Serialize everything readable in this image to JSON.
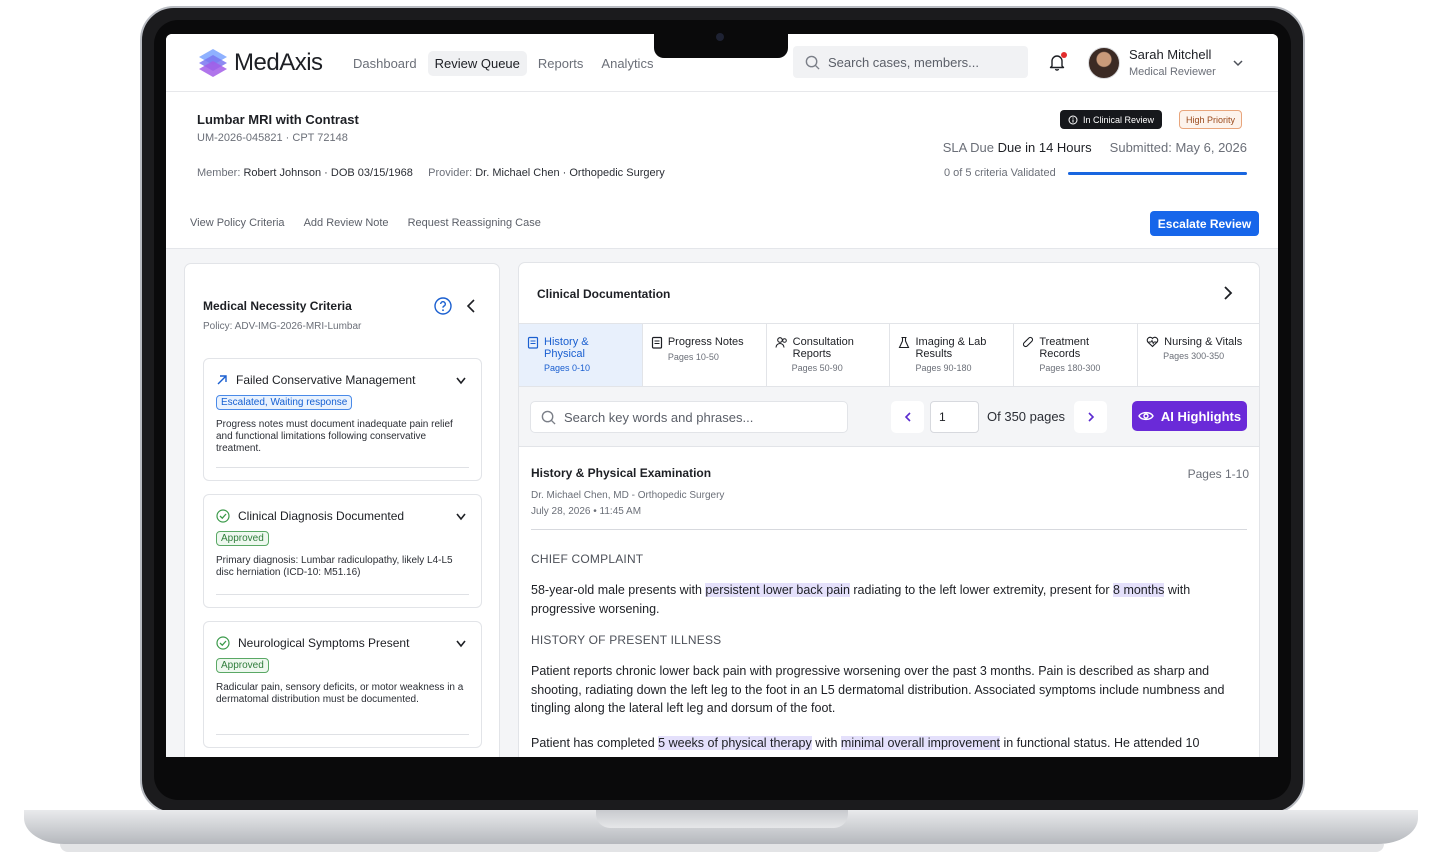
{
  "app": {
    "logo": "MedAxis",
    "nav": [
      "Dashboard",
      "Review Queue",
      "Reports",
      "Analytics"
    ],
    "active_nav": "Review Queue",
    "search_placeholder": "Search cases, members...",
    "user": {
      "name": "Sarah Mitchell",
      "role": "Medical Reviewer"
    }
  },
  "case": {
    "title": "Lumbar MRI with Contrast",
    "id_line": "UM-2026-045821 · CPT 72148",
    "member_label": "Member:",
    "member_value": "Robert Johnson · DOB 03/15/1968",
    "provider_label": "Provider:",
    "provider_value": "Dr. Michael Chen · Orthopedic Surgery",
    "status_badge": "In Clinical Review",
    "priority_badge": "High Priority",
    "sla_label": "SLA Due",
    "sla_value": "Due in 14 Hours",
    "submitted_label": "Submitted:",
    "submitted_value": "May 6, 2026",
    "criteria_progress_text": "0 of 5 criteria Validated",
    "criteria_progress_fraction": 1.0,
    "actions": [
      "View Policy Criteria",
      "Add Review Note",
      "Request Reassigning Case"
    ],
    "escalate_label": "Escalate Review"
  },
  "criteria_panel": {
    "title": "Medical Necessity Criteria",
    "policy": "Policy: ADV-IMG-2026-MRI-Lumbar",
    "items": [
      {
        "name": "Failed Conservative Management",
        "status": "Escalated, Waiting response",
        "status_type": "escalated",
        "icon": "arrow-up-right-icon",
        "text": "Progress notes must document inadequate pain relief and functional limitations following conservative treatment."
      },
      {
        "name": "Clinical Diagnosis Documented",
        "status": "Approved",
        "status_type": "approved",
        "icon": "check-circle-icon",
        "text": "Primary diagnosis: Lumbar radiculopathy, likely L4-L5 disc herniation (ICD-10: M51.16)"
      },
      {
        "name": "Neurological Symptoms Present",
        "status": "Approved",
        "status_type": "approved",
        "icon": "check-circle-icon",
        "text": "Radicular pain, sensory deficits, or motor weakness in a dermatomal distribution must be documented."
      }
    ]
  },
  "docs": {
    "title": "Clinical Documentation",
    "tabs": [
      {
        "label": "History & Physical",
        "pages": "Pages 0-10",
        "icon": "clipboard-icon"
      },
      {
        "label": "Progress Notes",
        "pages": "Pages 10-50",
        "icon": "notes-icon"
      },
      {
        "label": "Consultation Reports",
        "pages": "Pages 50-90",
        "icon": "users-icon"
      },
      {
        "label": "Imaging & Lab Results",
        "pages": "Pages 90-180",
        "icon": "flask-icon"
      },
      {
        "label": "Treatment Records",
        "pages": "Pages 180-300",
        "icon": "pill-icon"
      },
      {
        "label": "Nursing & Vitals",
        "pages": "Pages 300-350",
        "icon": "heart-pulse-icon"
      }
    ],
    "search_placeholder": "Search key words and phrases...",
    "page_value": "1",
    "page_total": "Of 350 pages",
    "ai_label": "AI Highlights",
    "section_title": "History & Physical Examination",
    "section_pages": "Pages 1-10",
    "author": "Dr. Michael Chen, MD - Orthopedic Surgery",
    "date": "July 28, 2026 • 11:45 AM",
    "chief_complaint_heading": "CHIEF COMPLAINT",
    "cc": {
      "a": "58-year-old male presents with ",
      "h1": "persistent lower back pain",
      "b": " radiating to the left lower extremity, present for ",
      "h2": "8 months",
      "c": " with progressive worsening."
    },
    "hpi_heading": "HISTORY OF PRESENT ILLNESS",
    "hpi_p1": "Patient reports chronic lower back pain with progressive worsening over the past 3 months. Pain is described as sharp and shooting, radiating down the left leg to the foot in an L5 dermatomal distribution. Associated symptoms include numbness and tingling along the lateral left leg and dorsum of the foot.",
    "hpi_p2": {
      "a": "Patient has completed ",
      "h1": "5 weeks of physical therapy",
      "b": " with ",
      "h2": "minimal overall improvement",
      "c": " in functional status. He attended 10"
    }
  }
}
